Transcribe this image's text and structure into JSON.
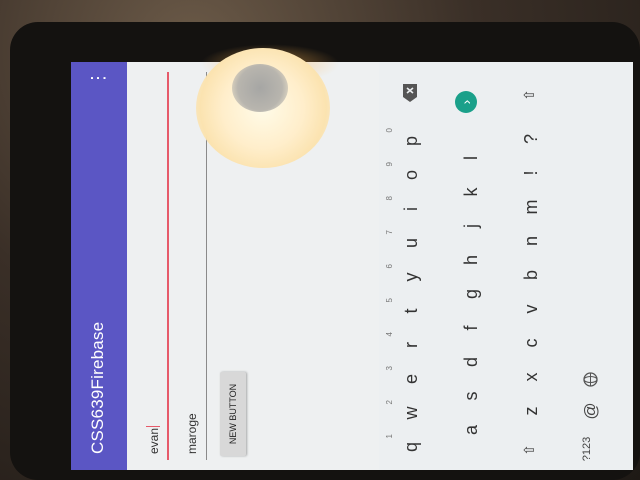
{
  "app": {
    "title": "CSS639Firebase",
    "menu_icon": "⋮"
  },
  "form": {
    "field1_value": "evan",
    "field2_value": "maroge",
    "button_label": "NEW BUTTON"
  },
  "colors": {
    "app_bar": "#5b56c4",
    "accent": "#e65a6a",
    "enter_key": "#1aa08a"
  },
  "keyboard": {
    "row1": [
      {
        "key": "q",
        "hint": "1"
      },
      {
        "key": "w",
        "hint": "2"
      },
      {
        "key": "e",
        "hint": "3"
      },
      {
        "key": "r",
        "hint": "4"
      },
      {
        "key": "t",
        "hint": "5"
      },
      {
        "key": "y",
        "hint": "6"
      },
      {
        "key": "u",
        "hint": "7"
      },
      {
        "key": "i",
        "hint": "8"
      },
      {
        "key": "o",
        "hint": "9"
      },
      {
        "key": "p",
        "hint": "0"
      }
    ],
    "backspace_icon": "backspace-icon",
    "row2": [
      "a",
      "s",
      "d",
      "f",
      "g",
      "h",
      "j",
      "k",
      "l"
    ],
    "enter_icon": "›",
    "row3": [
      "z",
      "x",
      "c",
      "v",
      "b",
      "n",
      "m",
      "!",
      "?"
    ],
    "shift_icon": "⇧",
    "row4": {
      "symbols": "?123",
      "at": "@",
      "globe_icon": "globe-icon"
    }
  }
}
